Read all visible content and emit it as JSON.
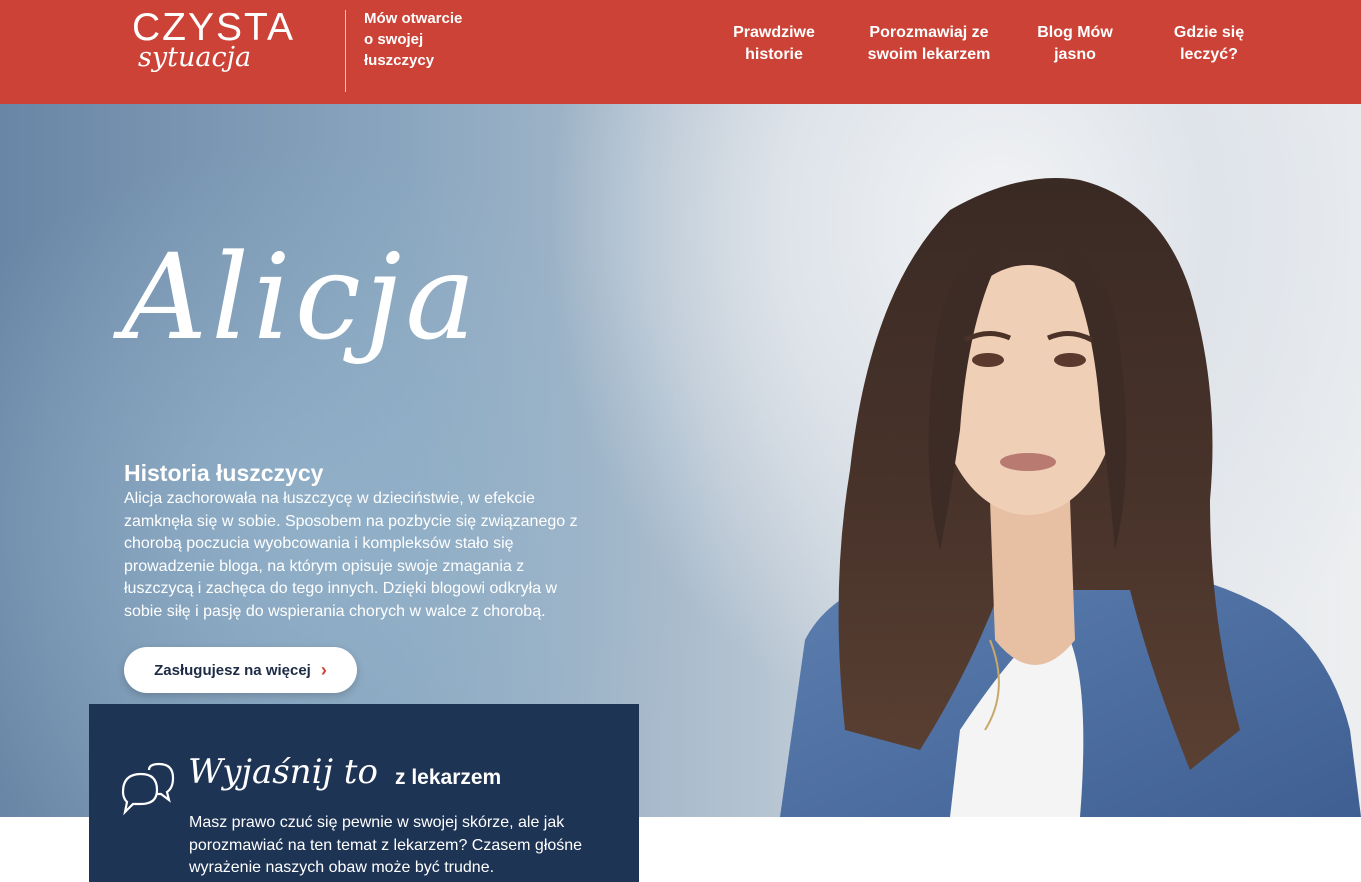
{
  "colors": {
    "brand_red": "#cc4236",
    "navy": "#1e3455",
    "white": "#ffffff"
  },
  "header": {
    "logo_main": "CZYSTA",
    "logo_script": "sytuacja",
    "tagline": "Mów otwarcie o swojej łuszczycy",
    "nav": [
      {
        "label": "Prawdziwe historie"
      },
      {
        "label": "Porozmawiaj ze swoim lekarzem"
      },
      {
        "label": "Blog Mów jasno"
      },
      {
        "label": "Gdzie się leczyć?"
      }
    ]
  },
  "hero": {
    "name": "Alicja",
    "heading": "Historia łuszczycy",
    "text": "Alicja zachorowała na łuszczycę w dzieciństwie, w efekcie zamknęła się w sobie. Sposobem na pozbycie się związanego z chorobą poczucia wyobcowania i kompleksów stało się prowadzenie bloga, na którym opisuje swoje zmagania z łuszczycą i zachęca do tego innych. Dzięki blogowi odkryła w sobie siłę i pasję do wspierania chorych w walce z chorobą.",
    "cta_label": "Zasługujesz na więcej",
    "cta_icon": "chevron-right-icon"
  },
  "card": {
    "icon": "chat-bubbles-icon",
    "title_script": "Wyjaśnij to",
    "title_bold": "z lekarzem",
    "text": "Masz prawo czuć się pewnie w swojej skórze, ale jak porozmawiać na ten temat z lekarzem?  Czasem głośne wyrażenie naszych obaw może być trudne."
  }
}
